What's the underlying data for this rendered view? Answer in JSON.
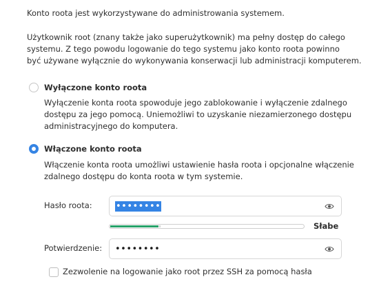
{
  "intro": "Konto roota jest wykorzystywane do administrowania systemem.",
  "description_lines": [
    "Użytkownik root (znany także jako superużytkownik) ma pełny dostęp do całego",
    "systemu. Z tego powodu logowanie do tego systemu jako konto roota powinno",
    "być używane wyłącznie do wykonywania konserwacji lub administracji komputerem."
  ],
  "disabled_option": {
    "label": "Wyłączone konto roota",
    "selected": false,
    "help_lines": [
      "Wyłączenie konta roota spowoduje jego zablokowanie i wyłączenie zdalnego",
      "dostępu za jego pomocą. Uniemożliwi to uzyskanie niezamierzonego dostępu",
      "administracyjnego do komputera."
    ]
  },
  "enabled_option": {
    "label": "Włączone konto roota",
    "selected": true,
    "help_lines": [
      "Włączenie konta roota umożliwi ustawienie hasła roota i opcjonalne włączenie",
      "zdalnego dostępu do konta roota w tym systemie."
    ]
  },
  "password": {
    "label": "Hasło roota:",
    "value": "••••••••",
    "icon": "eye-icon"
  },
  "strength": {
    "label": "Słabe",
    "level": 0.25,
    "color": "#26a269"
  },
  "confirm": {
    "label": "Potwierdzenie:",
    "value": "••••••••",
    "icon": "eye-icon"
  },
  "ssh_checkbox": {
    "label": "Zezwolenie na logowanie jako root przez SSH za pomocą hasła",
    "checked": false
  },
  "colors": {
    "accent": "#3584e4",
    "text": "#2e2e2e"
  }
}
